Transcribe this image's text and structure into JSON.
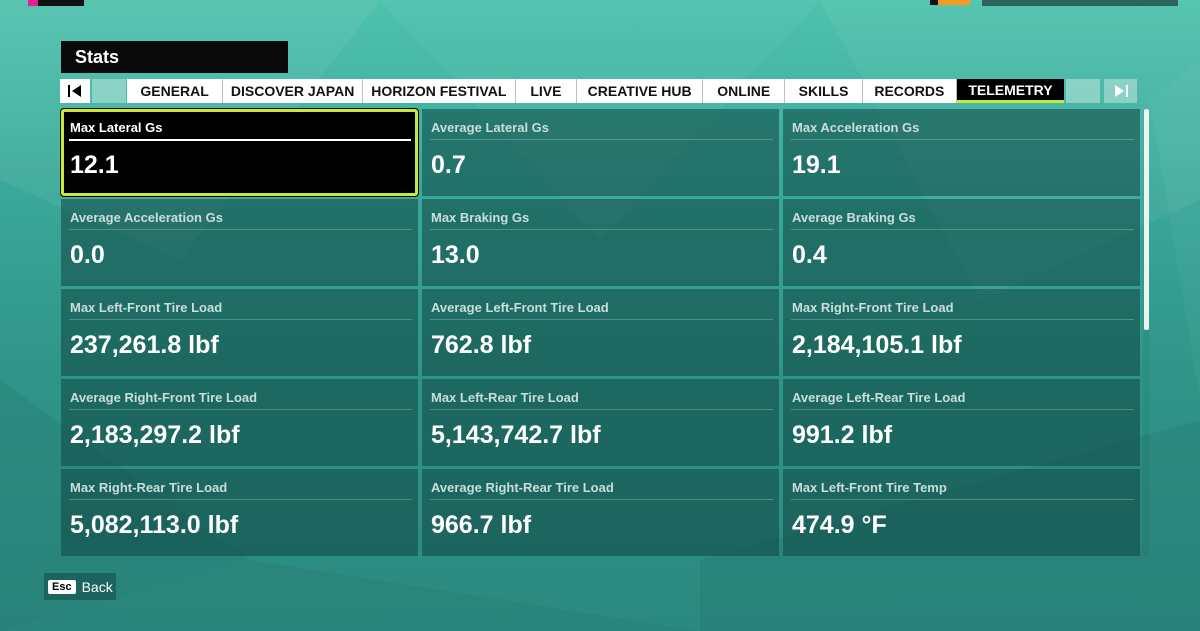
{
  "header": {
    "title": "Stats"
  },
  "tabs": [
    {
      "label": "GENERAL",
      "active": false
    },
    {
      "label": "DISCOVER JAPAN",
      "active": false
    },
    {
      "label": "HORIZON FESTIVAL",
      "active": false
    },
    {
      "label": "LIVE",
      "active": false
    },
    {
      "label": "CREATIVE HUB",
      "active": false
    },
    {
      "label": "ONLINE",
      "active": false
    },
    {
      "label": "SKILLS",
      "active": false
    },
    {
      "label": "RECORDS",
      "active": false
    },
    {
      "label": "TELEMETRY",
      "active": true
    }
  ],
  "stats": [
    {
      "label": "Max Lateral Gs",
      "value": "12.1"
    },
    {
      "label": "Average Lateral Gs",
      "value": "0.7"
    },
    {
      "label": "Max Acceleration Gs",
      "value": "19.1"
    },
    {
      "label": "Average Acceleration Gs",
      "value": "0.0"
    },
    {
      "label": "Max Braking Gs",
      "value": "13.0"
    },
    {
      "label": "Average Braking Gs",
      "value": "0.4"
    },
    {
      "label": "Max Left-Front Tire Load",
      "value": "237,261.8 lbf"
    },
    {
      "label": "Average Left-Front Tire Load",
      "value": "762.8 lbf"
    },
    {
      "label": "Max Right-Front Tire Load",
      "value": "2,184,105.1 lbf"
    },
    {
      "label": "Average Right-Front Tire Load",
      "value": "2,183,297.2 lbf"
    },
    {
      "label": "Max Left-Rear Tire Load",
      "value": "5,143,742.7 lbf"
    },
    {
      "label": "Average Left-Rear Tire Load",
      "value": "991.2 lbf"
    },
    {
      "label": "Max Right-Rear Tire Load",
      "value": "5,082,113.0 lbf"
    },
    {
      "label": "Average Right-Rear Tire Load",
      "value": "966.7 lbf"
    },
    {
      "label": "Max Left-Front Tire Temp",
      "value": "474.9 °F"
    }
  ],
  "selected_stat": "Max Lateral Gs",
  "footer": {
    "key_label": "Esc",
    "back_label": "Back"
  },
  "icons": {
    "prev": "prev-tab-icon",
    "next": "next-tab-icon"
  },
  "colors": {
    "accent": "#c5ea3a",
    "background": "#3aa89a",
    "card": "#0f4641"
  }
}
